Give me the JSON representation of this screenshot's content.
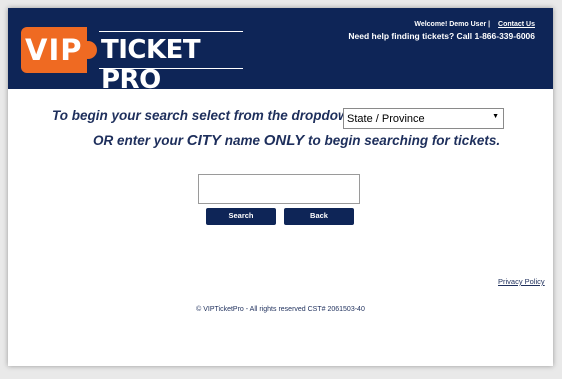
{
  "header": {
    "logo_vip": "VIP",
    "logo_text": "TICKET PRO",
    "welcome": "Welcome! Demo User |",
    "contact_link": "Contact Us",
    "help_text": "Need help finding tickets? Call 1-866-339-6006"
  },
  "main": {
    "instruction_line1": "To begin your search select from the dropdown:",
    "state_select_value": "State / Province",
    "instruction_line2_a": "OR enter your ",
    "instruction_line2_city": "CITY",
    "instruction_line2_b": " name ",
    "instruction_line2_only": "ONLY",
    "instruction_line2_c": " to begin searching for tickets.",
    "search_value": "",
    "search_button": "Search",
    "back_button": "Back"
  },
  "footer": {
    "privacy_link": "Privacy Policy",
    "copyright": "© VIPTicketPro - All rights reserved CST# 2061503-40"
  },
  "colors": {
    "header_bg": "#0e2557",
    "logo_orange": "#ef6a22",
    "text_navy": "#1e2f5c"
  }
}
